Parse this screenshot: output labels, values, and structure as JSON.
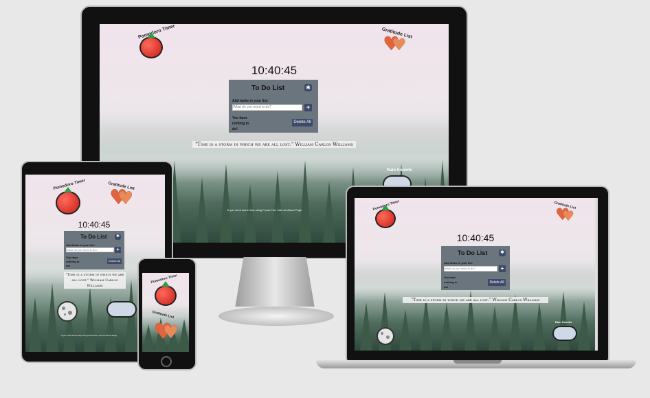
{
  "app": {
    "pomodoro_label": "Pomodoro Timer",
    "gratitude_label": "Gratitude List",
    "rain_label": "Rain Sounds",
    "clock": "10:40:45",
    "todo": {
      "title": "To Do List",
      "add_label": "Add tasks to your list:",
      "input_placeholder": "What do you need to do?",
      "empty_text": "You have nothing to do!",
      "delete_button": "Delete All",
      "add_button": "+"
    },
    "quote": "\"Time is a storm in which we are all lost.\" William Carlos Williams",
    "footer": "If you need some help using Focus Pod, visit our About Page",
    "tablet_footer": "If you need some help using Focus Pod, visit our About Page"
  },
  "icons": {
    "gear": "gear-icon",
    "tomato": "tomato-icon",
    "hearts": "hearts-icon",
    "cloud": "rain-cloud-icon",
    "moon": "moon-icon"
  },
  "colors": {
    "todo_panel": "#6b757d",
    "button": "#3d4a6a",
    "tomato": "#e03a2f",
    "heart": "#e0643d"
  }
}
